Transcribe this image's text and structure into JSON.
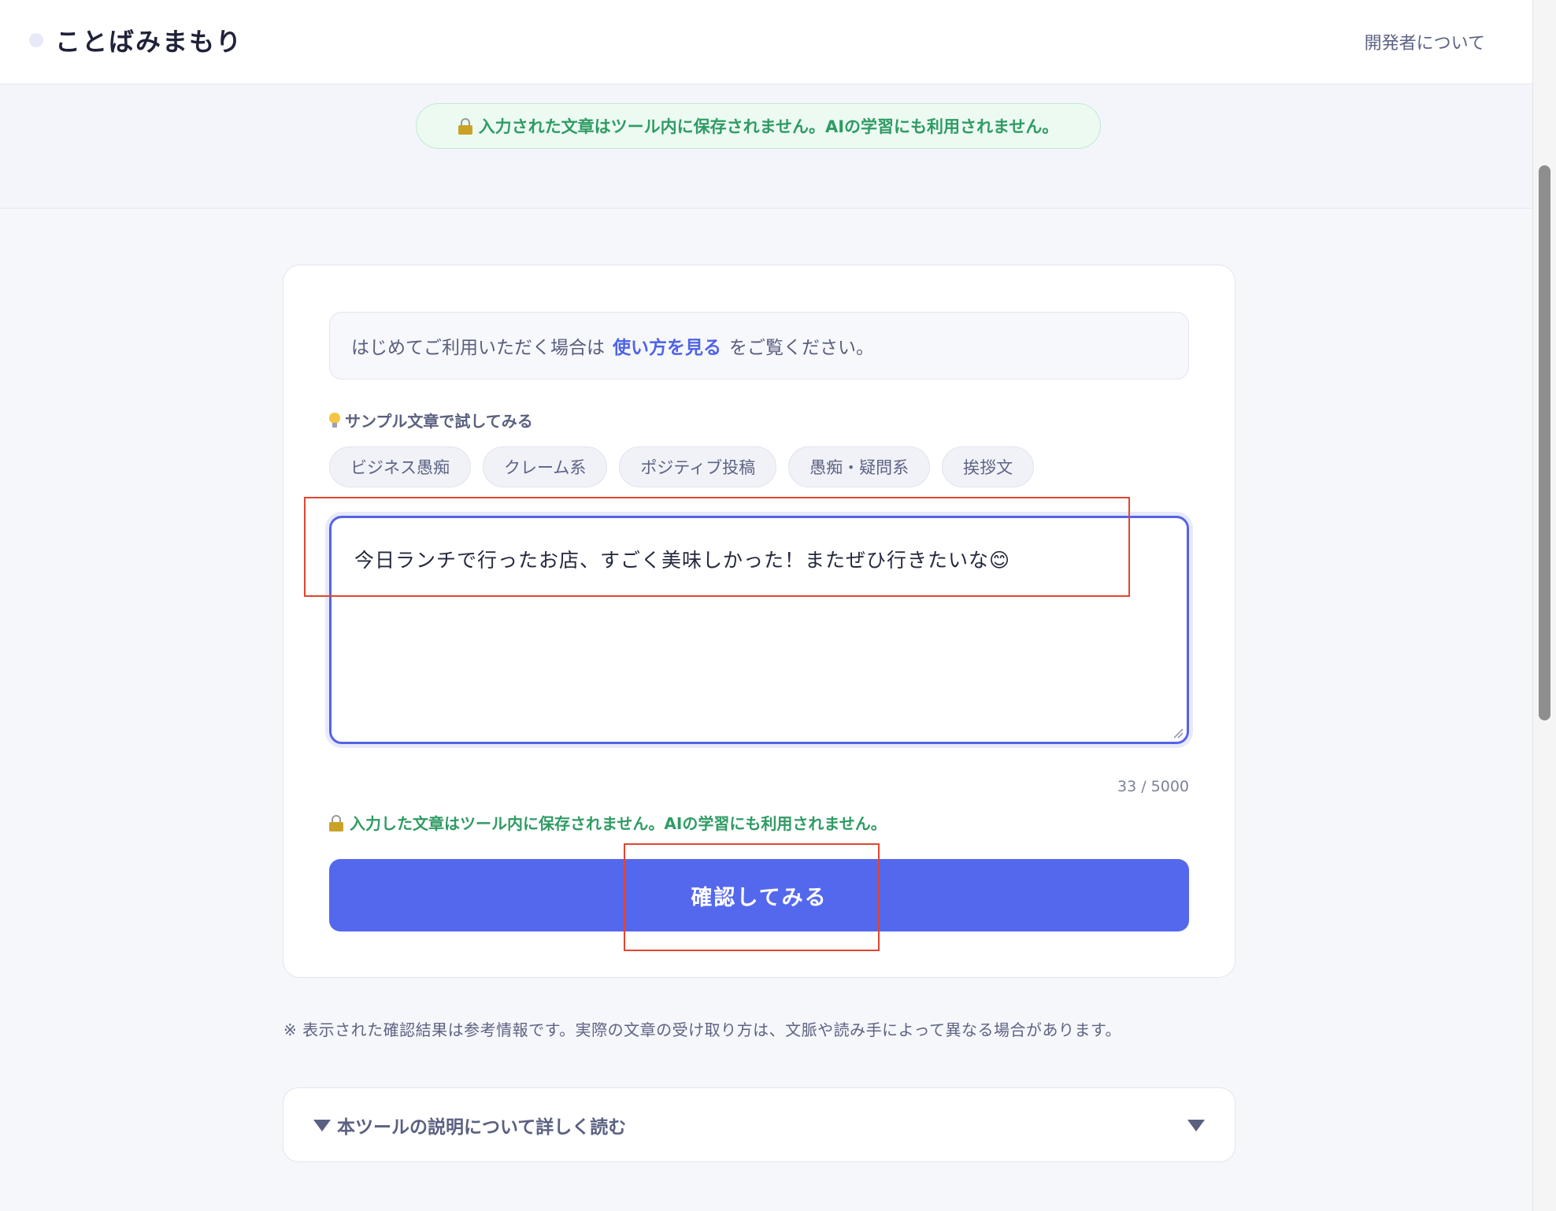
{
  "header": {
    "logo_text": "ことばみまもり",
    "about_link": "開発者について"
  },
  "banner": {
    "privacy_text": "入力された文章はツール内に保存されません。AIの学習にも利用されません。"
  },
  "card": {
    "intro_prefix": "はじめてご利用いただく場合は",
    "intro_link": "使い方を見る",
    "intro_suffix": "をご覧ください。",
    "sample_label": "サンプル文章で試してみる",
    "samples": [
      {
        "label": "ビジネス愚痴"
      },
      {
        "label": "クレーム系"
      },
      {
        "label": "ポジティブ投稿"
      },
      {
        "label": "愚痴・疑問系"
      },
      {
        "label": "挨拶文"
      }
    ],
    "input_text": "今日ランチで行ったお店、すごく美味しかった！またぜひ行きたいな😊",
    "char_count": "33 / 5000",
    "privacy_note": "入力した文章はツール内に保存されません。AIの学習にも利用されません。",
    "confirm_button": "確認してみる"
  },
  "disclaimer": "※ 表示された確認結果は参考情報です。実際の文章の受け取り方は、文脈や読み手によって異なる場合があります。",
  "details": {
    "label": "本ツールの説明について詳しく読む"
  },
  "icons": {
    "lock": "lock-icon",
    "bulb": "lightbulb-icon",
    "disclosure": "triangle-down-icon"
  },
  "colors": {
    "accent": "#5468ee",
    "privacy_green": "#2f9b63",
    "annotation_red": "#e2452f"
  }
}
